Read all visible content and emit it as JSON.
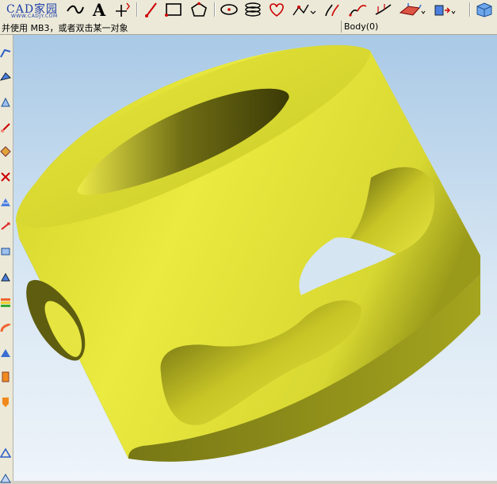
{
  "logo": {
    "text": "CAD家园",
    "url_text": "WWW.CADJY.COM"
  },
  "toolbar": {
    "text_tool_label": "A",
    "icons": [
      "spline-icon",
      "text-icon",
      "point-icon",
      "line-icon",
      "rectangle-icon",
      "polygon-icon",
      "ellipse-icon",
      "helix-icon",
      "heart-curve-icon",
      "curve-edit-icon",
      "offset-curve-icon",
      "bridge-curve-icon",
      "project-curve-icon",
      "surface-icon",
      "extrude-icon",
      "view-cube-icon"
    ]
  },
  "status": {
    "prompt": "并使用 MB3，或者双击某一对象",
    "body_field": "Body(0)"
  },
  "colors": {
    "part_yellow": "#e4e43a",
    "part_dark": "#6d6d12",
    "viewport_top": "#a9c9e6",
    "viewport_bottom": "#eef4fa"
  }
}
